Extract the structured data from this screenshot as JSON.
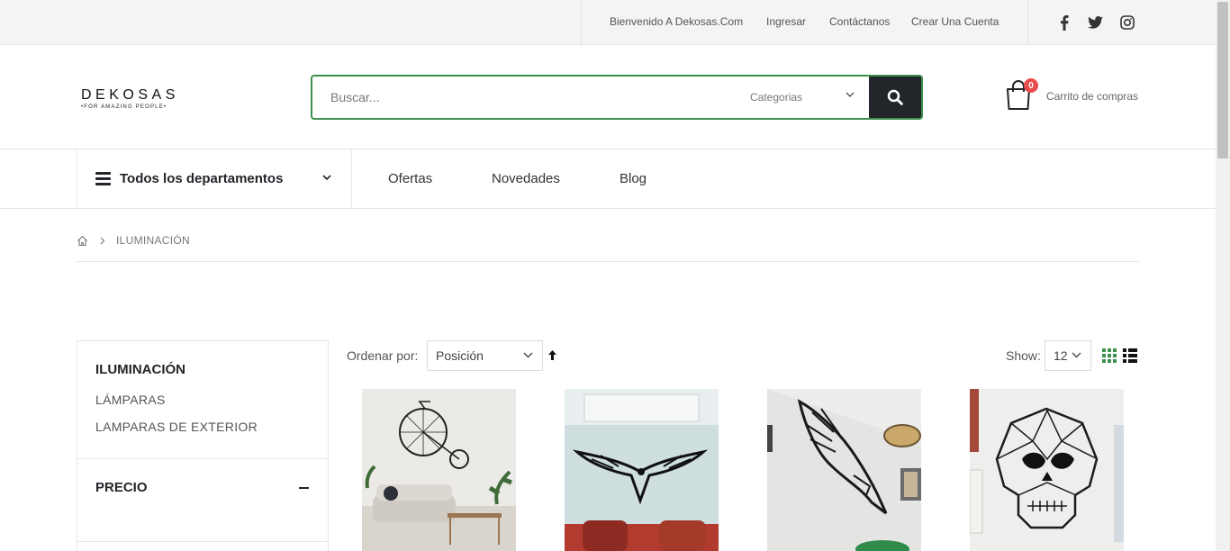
{
  "topbar": {
    "welcome": "Bienvenido A Dekosas.Com",
    "login": "Ingresar",
    "contact": "Contáctanos",
    "create_account": "Crear Una Cuenta",
    "social": [
      "facebook-icon",
      "twitter-icon",
      "instagram-icon"
    ]
  },
  "header": {
    "logo_text": "DEKOSAS",
    "logo_tagline": "•FOR AMAZING PEOPLE•",
    "search_placeholder": "Buscar...",
    "category_select": "Categorias",
    "cart_count": "0",
    "cart_label": "Carrito de compras"
  },
  "nav": {
    "departments": "Todos los departamentos",
    "links": [
      "Ofertas",
      "Novedades",
      "Blog"
    ]
  },
  "breadcrumb": {
    "current": "ILUMINACIÓN"
  },
  "sidebar": {
    "title": "ILUMINACIÓN",
    "items": [
      "LÁMPARAS",
      "LAMPARAS DE EXTERIOR"
    ],
    "price_title": "PRECIO"
  },
  "toolbar": {
    "sort_label": "Ordenar por:",
    "sort_value": "Posición",
    "show_label": "Show:",
    "show_value": "12"
  },
  "colors": {
    "accent_green": "#3c8f4c",
    "dark": "#222529",
    "badge_red": "#e94c4c"
  }
}
